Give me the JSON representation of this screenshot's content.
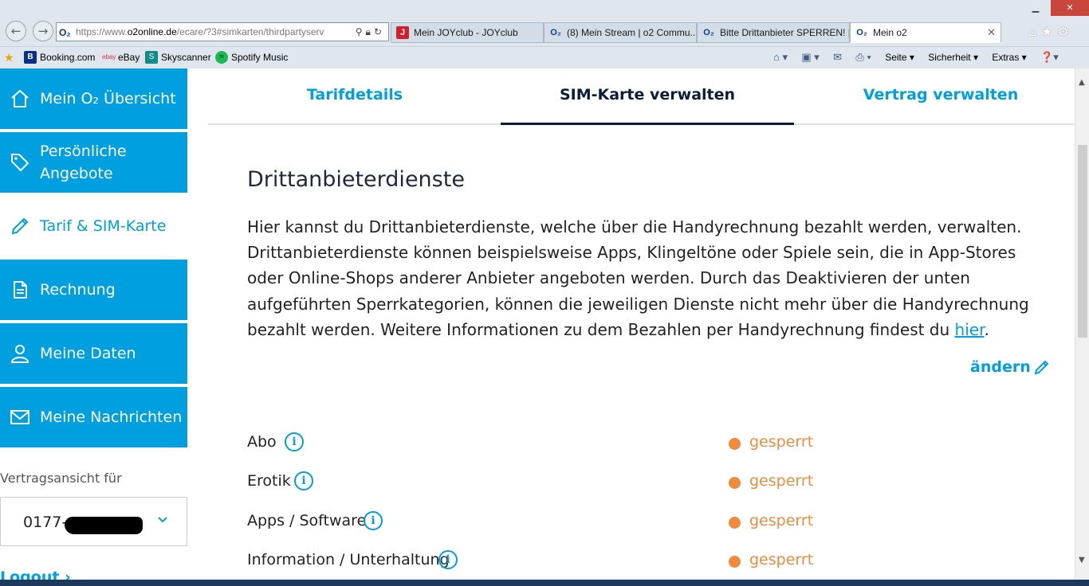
{
  "browser": {
    "url_prefix": "https://www.",
    "url_domain": "o2online.de",
    "url_rest": "/ecare/?3#simkarten/thirdpartyserv",
    "tabs": [
      {
        "label": "Mein JOYclub - JOYclub",
        "icon": "J"
      },
      {
        "label": "(8) Mein Stream | o2 Commu...",
        "icon": "O₂"
      },
      {
        "label": "Bitte Drittanbieter SPERREN! |...",
        "icon": "O₂"
      },
      {
        "label": "Mein o2",
        "icon": "O₂"
      }
    ],
    "favorites": [
      {
        "label": "Booking.com",
        "icon": "B"
      },
      {
        "label": "eBay",
        "icon": "ebay"
      },
      {
        "label": "Skyscanner",
        "icon": "S"
      },
      {
        "label": "Spotify Music",
        "icon": "≈"
      }
    ],
    "commands": [
      "Seite ▾",
      "Sicherheit ▾",
      "Extras ▾"
    ]
  },
  "sidebar": {
    "items": [
      {
        "label": "Mein O₂ Übersicht",
        "icon": "home-icon"
      },
      {
        "label": "Persönliche Angebote",
        "icon": "tag-icon"
      },
      {
        "label": "Tarif & SIM-Karte",
        "icon": "pencil-icon"
      },
      {
        "label": "Rechnung",
        "icon": "document-icon"
      },
      {
        "label": "Meine Daten",
        "icon": "user-icon"
      },
      {
        "label": "Meine Nachrichten",
        "icon": "envelope-icon"
      }
    ],
    "contract_label": "Vertragsansicht für",
    "contract_number": "0177-",
    "logout": "Logout ›"
  },
  "main": {
    "tabs": [
      "Tarifdetails",
      "SIM-Karte verwalten",
      "Vertrag verwalten"
    ],
    "title": "Drittanbieterdienste",
    "intro": "Hier kannst du Drittanbieterdienste, welche über die Handyrechnung bezahlt werden, verwalten. Drittanbieterdienste können beispielsweise Apps, Klingeltöne oder Spiele sein, die in App-Stores oder Online-Shops anderer Anbieter angeboten werden. Durch das Deaktivieren der unten aufgeführten Sperrkategorien, können die jeweiligen Dienste nicht mehr über die Handyrechnung bezahlt werden. Weitere Informationen zu dem Bezahlen per Handyrechnung findest du ",
    "intro_link": "hier",
    "intro_end": ".",
    "edit": "ändern",
    "rows": [
      {
        "label": "Abo",
        "status": "gesperrt"
      },
      {
        "label": "Erotik",
        "status": "gesperrt"
      },
      {
        "label": "Apps / Software",
        "status": "gesperrt"
      },
      {
        "label": "Information / Unterhaltung",
        "status": "gesperrt"
      }
    ]
  },
  "colors": {
    "brand": "#009fdf",
    "status_blocked": "#f08a3c",
    "dark": "#0a1e3a"
  }
}
